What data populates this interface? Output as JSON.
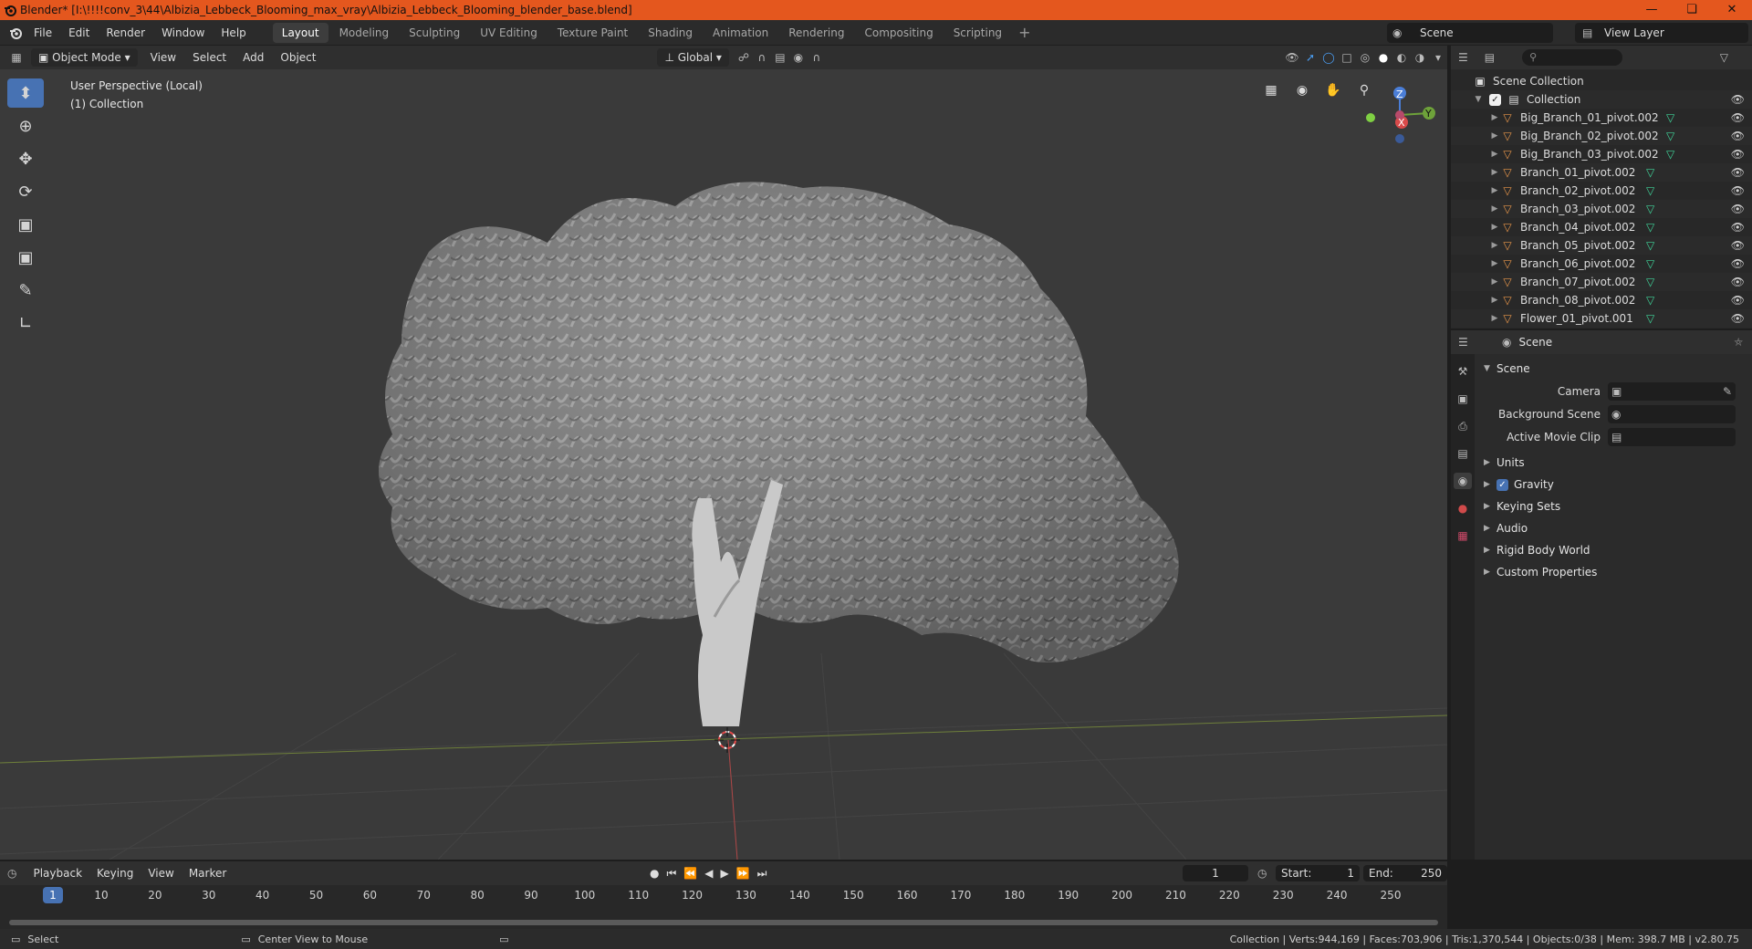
{
  "window": {
    "title": "Blender* [I:\\!!!!conv_3\\44\\Albizia_Lebbeck_Blooming_max_vray\\Albizia_Lebbeck_Blooming_blender_base.blend]"
  },
  "menubar": {
    "menus": [
      "File",
      "Edit",
      "Render",
      "Window",
      "Help"
    ],
    "workspaces": [
      "Layout",
      "Modeling",
      "Sculpting",
      "UV Editing",
      "Texture Paint",
      "Shading",
      "Animation",
      "Rendering",
      "Compositing",
      "Scripting"
    ],
    "active_workspace": "Layout",
    "scene": "Scene",
    "view_layer": "View Layer"
  },
  "viewport_header": {
    "mode": "Object Mode",
    "menus": [
      "View",
      "Select",
      "Add",
      "Object"
    ],
    "orientation": "Global"
  },
  "viewport": {
    "perspective": "User Perspective (Local)",
    "collection": "(1) Collection",
    "gizmo_axes": [
      "Z",
      "Y",
      "X"
    ]
  },
  "outliner": {
    "root": "Scene Collection",
    "collection": "Collection",
    "objects": [
      "Big_Branch_01_pivot.002",
      "Big_Branch_02_pivot.002",
      "Big_Branch_03_pivot.002",
      "Branch_01_pivot.002",
      "Branch_02_pivot.002",
      "Branch_03_pivot.002",
      "Branch_04_pivot.002",
      "Branch_05_pivot.002",
      "Branch_06_pivot.002",
      "Branch_07_pivot.002",
      "Branch_08_pivot.002",
      "Flower_01_pivot.001"
    ]
  },
  "properties": {
    "header": "Scene",
    "section": "Scene",
    "fields": [
      {
        "label": "Camera"
      },
      {
        "label": "Background Scene"
      },
      {
        "label": "Active Movie Clip"
      }
    ],
    "subsections": [
      "Units",
      "Gravity",
      "Keying Sets",
      "Audio",
      "Rigid Body World",
      "Custom Properties"
    ],
    "gravity_checked": true
  },
  "timeline": {
    "menus": [
      "Playback",
      "Keying",
      "View",
      "Marker"
    ],
    "current_frame": "1",
    "start_label": "Start:",
    "start": "1",
    "end_label": "End:",
    "end": "250",
    "ruler": [
      "1",
      "10",
      "20",
      "30",
      "40",
      "50",
      "60",
      "70",
      "80",
      "90",
      "100",
      "110",
      "120",
      "130",
      "140",
      "150",
      "160",
      "170",
      "180",
      "190",
      "200",
      "210",
      "220",
      "230",
      "240",
      "250"
    ]
  },
  "statusbar": {
    "left": "Select",
    "middle": "Center View to Mouse",
    "stats": "Collection | Verts:944,169 | Faces:703,906 | Tris:1,370,544 | Objects:0/38 | Mem: 398.7 MB | v2.80.75"
  },
  "colors": {
    "titlebar": "#e4571e",
    "accent": "#4772b3",
    "mesh_icon": "#3fd59a",
    "object_icon": "#e8964a"
  }
}
